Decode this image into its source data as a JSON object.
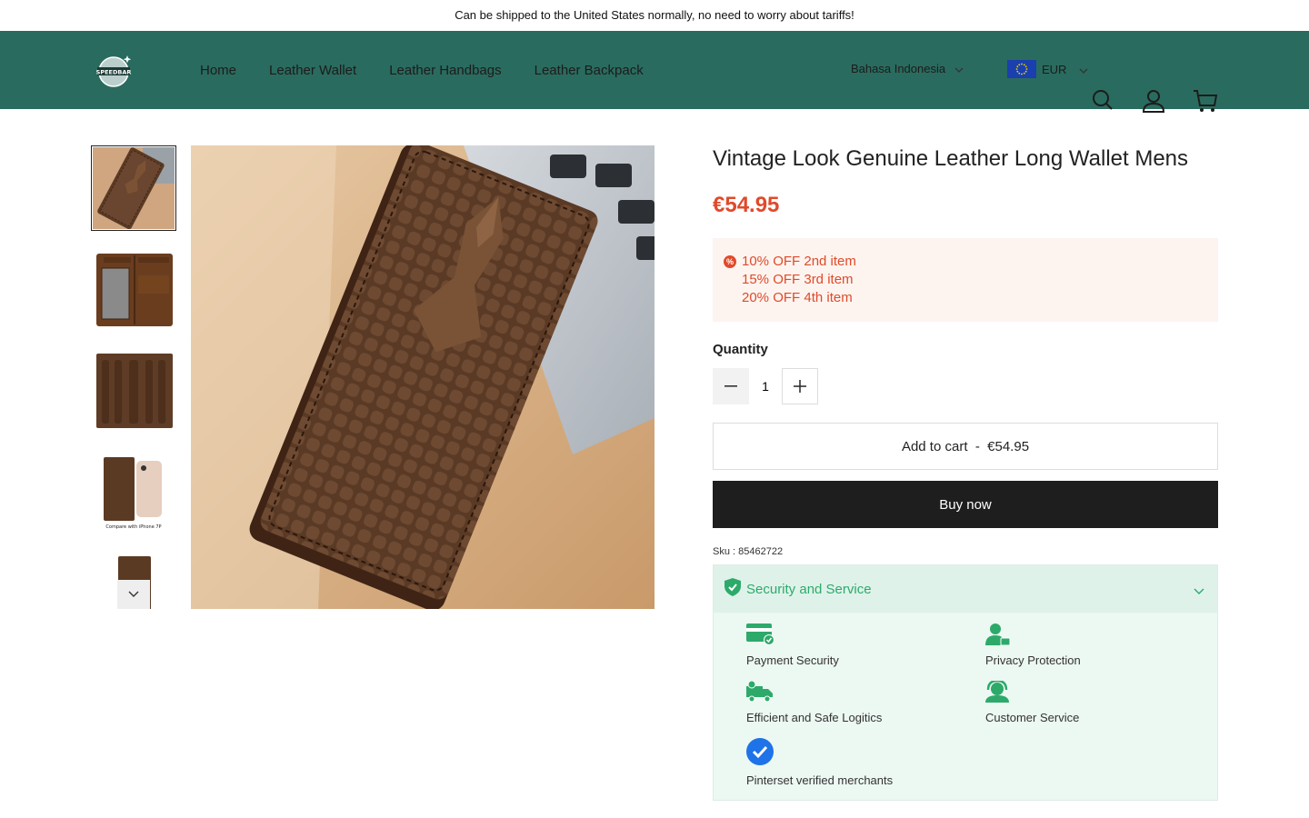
{
  "announcement": "Can be shipped to the United States normally, no need to worry about tariffs!",
  "header": {
    "logo_text": "SPEEDBAR",
    "nav": [
      "Home",
      "Leather Wallet",
      "Leather Handbags",
      "Leather Backpack"
    ],
    "language": "Bahasa Indonesia",
    "currency": "EUR"
  },
  "gallery": {
    "thumbnail_caption": "Compare with iPhone 7P"
  },
  "product": {
    "title": "Vintage Look Genuine Leather Long Wallet Mens",
    "price": "€54.95",
    "promotions": [
      "10% OFF 2nd item",
      "15% OFF 3rd item",
      "20% OFF 4th item"
    ],
    "quantity_label": "Quantity",
    "quantity": "1",
    "add_to_cart": "Add to cart  -  €54.95",
    "buy_now": "Buy now",
    "sku": "Sku : 85462722"
  },
  "security": {
    "title": "Security and Service",
    "features": [
      "Payment Security",
      "Privacy Protection",
      "Efficient and Safe Logitics",
      "Customer Service",
      "Pinterset verified merchants"
    ]
  },
  "colors": {
    "header_bg": "#2a6b5f",
    "price": "#e04a2b",
    "security_green": "#2daa6a"
  }
}
